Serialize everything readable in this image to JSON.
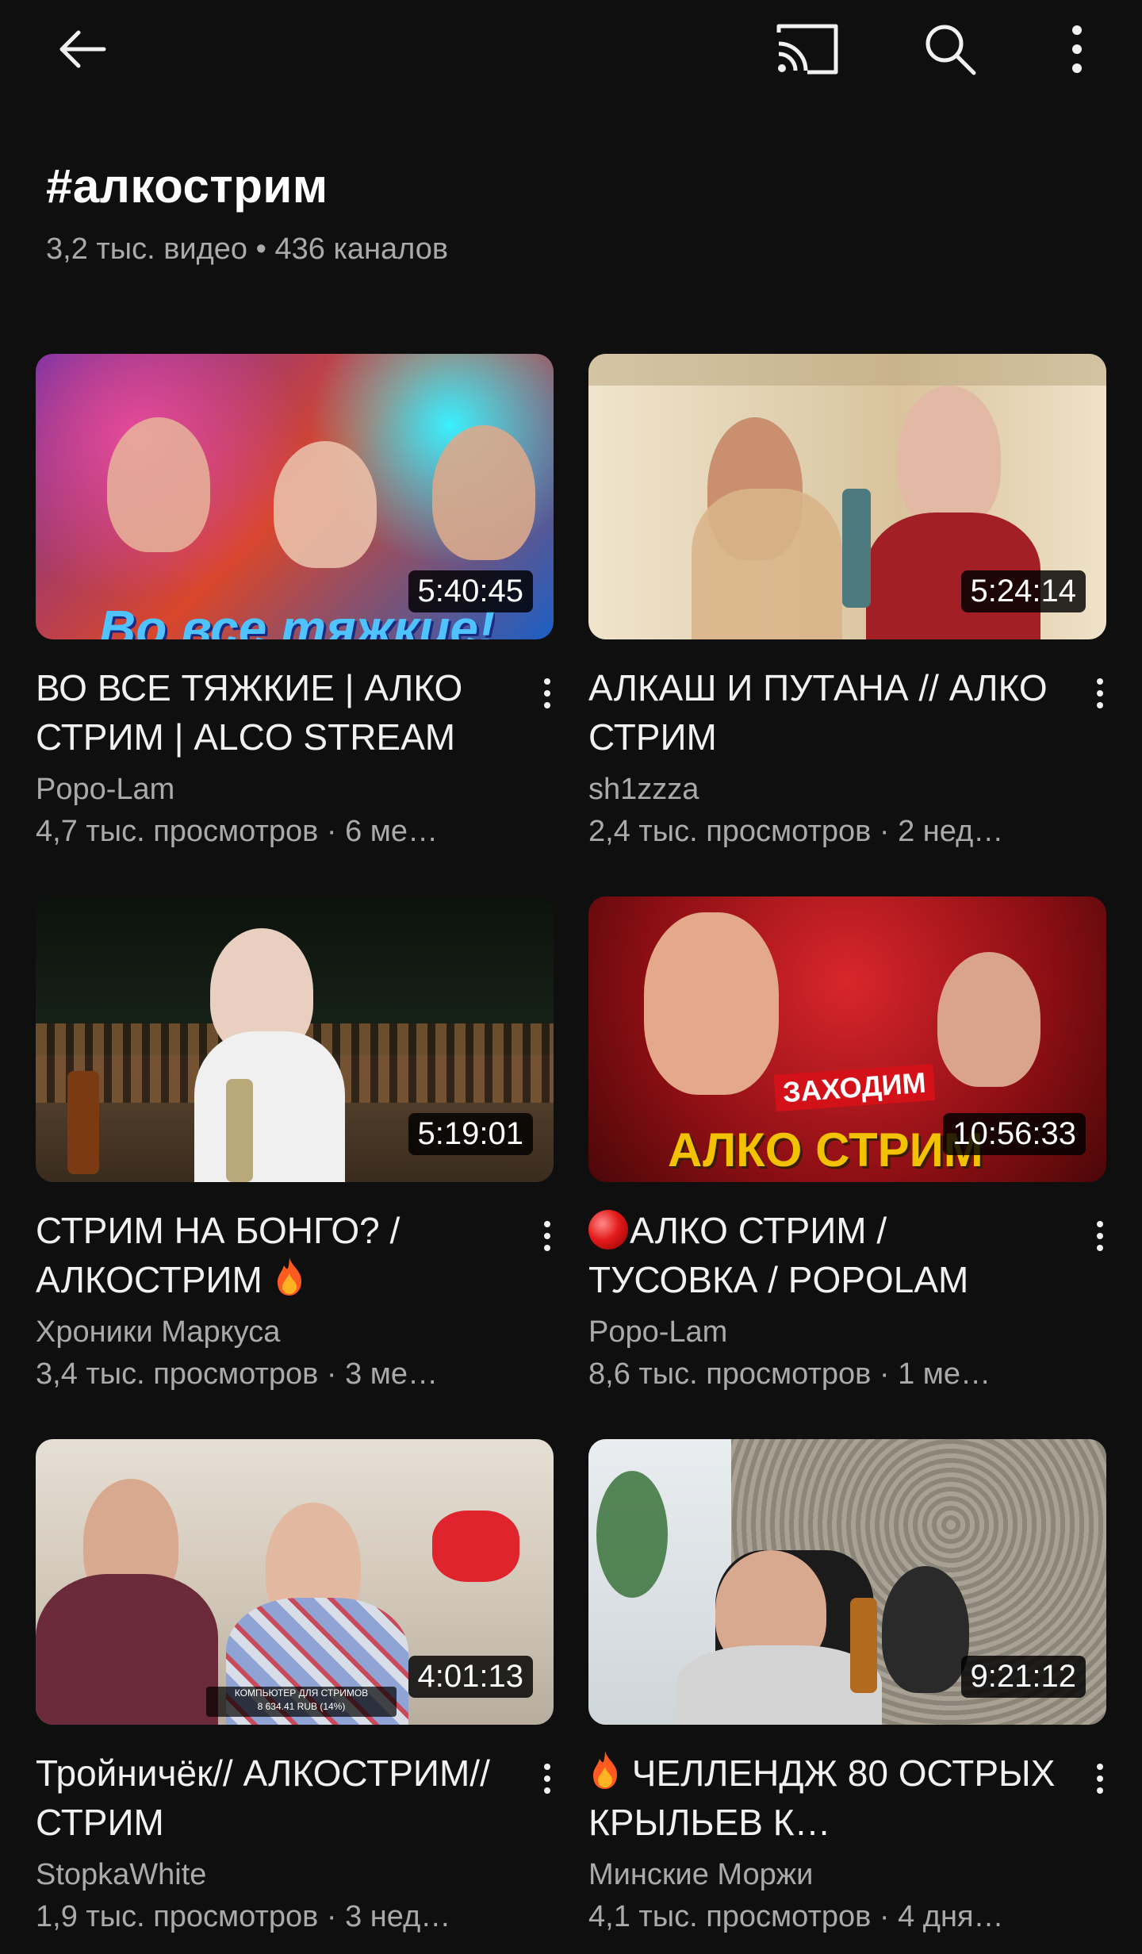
{
  "topbar": {
    "back_icon": "arrow-left-icon",
    "cast_icon": "cast-icon",
    "search_icon": "search-icon",
    "more_icon": "more-vert-icon"
  },
  "hashtag": {
    "title": "#алкострим",
    "stats": "3,2 тыс. видео • 436 каналов"
  },
  "videos": [
    {
      "title": "ВО ВСЕ ТЯЖКИЕ | АЛКО СТРИМ | ALCO STREAM",
      "channel": "Popo-Lam",
      "views": "4,7 тыс. просмотров · 6 ме…",
      "duration": "5:40:45",
      "thumb_colors": [
        "#6b2fa8",
        "#d9462b",
        "#1c5fc4"
      ],
      "thumb_caption": "Во все тяжкие!"
    },
    {
      "title": "АЛКАШ И ПУТАНА  // АЛКО СТРИМ",
      "channel": "sh1zzza",
      "views": "2,4 тыс. просмотров · 2 нед…",
      "duration": "5:24:14",
      "thumb_colors": [
        "#e8d8bf",
        "#c9b18a",
        "#8f1f1f"
      ],
      "thumb_caption": ""
    },
    {
      "title": "СТРИМ НА БОНГО? / АЛКОСТРИМ",
      "channel": "Хроники Маркуса",
      "views": "3,4 тыс. просмотров · 3 ме…",
      "duration": "5:19:01",
      "thumb_colors": [
        "#121712",
        "#6b4a2a",
        "#eeeeee"
      ],
      "thumb_caption": ""
    },
    {
      "title": "АЛКО СТРИМ / ТУСОВКА / POPOLAM",
      "channel": "Popo-Lam",
      "views": "8,6 тыс. просмотров · 1 ме…",
      "duration": "10:56:33",
      "thumb_colors": [
        "#7a0f14",
        "#c2161c",
        "#f2c200"
      ],
      "thumb_caption": "АЛКО СТРИМ",
      "thumb_badge": "ЗАХОДИМ"
    },
    {
      "title": "Тройничёк// АЛКОСТРИМ// СТРИМ",
      "channel": "StopkaWhite",
      "views": "1,9 тыс. просмотров · 3 нед…",
      "duration": "4:01:13",
      "thumb_colors": [
        "#d8cfc2",
        "#6a2a3a",
        "#c8d4e8"
      ],
      "thumb_caption": "КОМПЬЮТЕР ДЛЯ СТРИМОВ",
      "thumb_sub": "8 634.41 RUB (14%)"
    },
    {
      "title": "ЧЕЛЛЕНДЖ 80 ОСТРЫХ КРЫЛЬЕВ К…",
      "channel": "Минские Моржи",
      "views": "4,1 тыс. просмотров · 4 дня…",
      "duration": "9:21:12",
      "thumb_colors": [
        "#b8b2a6",
        "#6e6a62",
        "#2b2b2b"
      ],
      "thumb_caption": ""
    }
  ]
}
